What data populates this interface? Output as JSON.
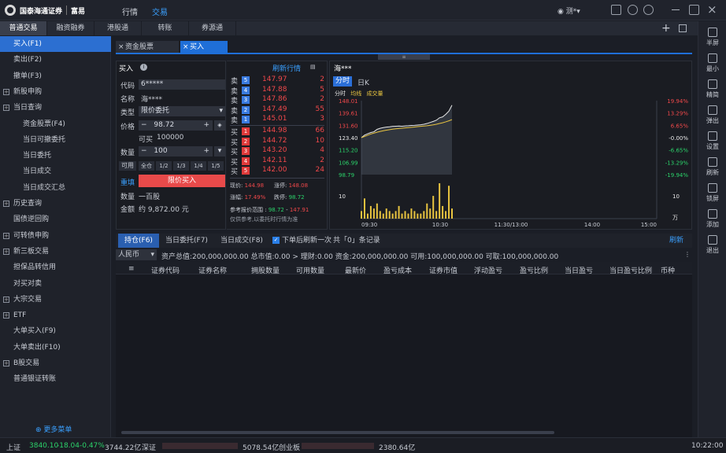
{
  "app": {
    "logo_text": "国泰海通证券",
    "logo_sub": "GUOTAI HAITONG SECURITIES",
    "logo_brand": "富易",
    "logo_brand_sub": "RICH EASY",
    "nav": [
      "行情",
      "交易"
    ],
    "active_nav": 1,
    "user": "测*"
  },
  "subtabs": [
    "普通交易",
    "融资融券",
    "港股通",
    "转账",
    "券源通"
  ],
  "sidebar": {
    "items": [
      {
        "label": "买入(F1)",
        "level": 1,
        "active": true,
        "plus": false
      },
      {
        "label": "卖出(F2)",
        "level": 1,
        "plus": false
      },
      {
        "label": "撤单(F3)",
        "level": 1,
        "plus": false
      },
      {
        "label": "新股申购",
        "level": 1,
        "plus": true
      },
      {
        "label": "当日查询",
        "level": 1,
        "plus": true
      },
      {
        "label": "资金股票(F4)",
        "level": 2
      },
      {
        "label": "当日可撤委托",
        "level": 2
      },
      {
        "label": "当日委托",
        "level": 2
      },
      {
        "label": "当日成交",
        "level": 2
      },
      {
        "label": "当日成交汇总",
        "level": 2
      },
      {
        "label": "历史查询",
        "level": 1,
        "plus": true
      },
      {
        "label": "国债逆回购",
        "level": 1,
        "plus": false
      },
      {
        "label": "可转债申购",
        "level": 1,
        "plus": true
      },
      {
        "label": "新三板交易",
        "level": 1,
        "plus": true
      },
      {
        "label": "担保品转信用",
        "level": 1,
        "plus": false
      },
      {
        "label": "对买对卖",
        "level": 1,
        "plus": false
      },
      {
        "label": "大宗交易",
        "level": 1,
        "plus": true
      },
      {
        "label": "ETF",
        "level": 1,
        "plus": true
      },
      {
        "label": "大单买入(F9)",
        "level": 1,
        "plus": false
      },
      {
        "label": "大单卖出(F10)",
        "level": 1,
        "plus": false
      },
      {
        "label": "B股交易",
        "level": 1,
        "plus": true
      },
      {
        "label": "普通银证转账",
        "level": 1,
        "plus": false
      }
    ],
    "more": "更多菜单"
  },
  "right_toolbar": [
    "半屏",
    "最小",
    "精简",
    "弹出",
    "设置",
    "刷新",
    "锁屏",
    "添加",
    "退出"
  ],
  "doc_tabs": [
    "资金股票",
    "买入"
  ],
  "order": {
    "title": "买入",
    "refresh_quote": "刷新行情",
    "code_label": "代码",
    "code": "6*****",
    "name_label": "名称",
    "name": "海****",
    "type_label": "类型",
    "type": "限价委托",
    "price_label": "价格",
    "price": "98.72",
    "buyable_label": "可买",
    "buyable": "100000",
    "qty_label": "数量",
    "qty": "100",
    "avail_label": "可用",
    "portions": [
      "全仓",
      "1/2",
      "1/3",
      "1/4",
      "1/5"
    ],
    "reset": "重填",
    "submit": "限价买入",
    "qty_text_label": "数量",
    "qty_text": "一百股",
    "amount_label": "金额",
    "amount_text": "约 9,872.00 元"
  },
  "orderbook": {
    "sells": [
      {
        "side": "卖",
        "n": "5",
        "price": "147.97",
        "vol": "2"
      },
      {
        "side": "卖",
        "n": "4",
        "price": "147.88",
        "vol": "5"
      },
      {
        "side": "卖",
        "n": "3",
        "price": "147.86",
        "vol": "2"
      },
      {
        "side": "卖",
        "n": "2",
        "price": "147.49",
        "vol": "55"
      },
      {
        "side": "卖",
        "n": "1",
        "price": "145.01",
        "vol": "3"
      }
    ],
    "buys": [
      {
        "side": "买",
        "n": "1",
        "price": "144.98",
        "vol": "66"
      },
      {
        "side": "买",
        "n": "2",
        "price": "144.72",
        "vol": "10"
      },
      {
        "side": "买",
        "n": "3",
        "price": "143.20",
        "vol": "4"
      },
      {
        "side": "买",
        "n": "4",
        "price": "142.11",
        "vol": "2"
      },
      {
        "side": "买",
        "n": "5",
        "price": "142.00",
        "vol": "24"
      }
    ],
    "now_label": "现价:",
    "now": "144.98",
    "limit_up_label": "涨停:",
    "limit_up": "148.08",
    "change_label": "涨幅:",
    "change": "17.49%",
    "limit_down_label": "跌停:",
    "limit_down": "98.72",
    "ref_label": "参考报价范围",
    "ref_low": "98.72",
    "ref_high": "147.91",
    "note": "仅供参考,以委托时行情为准"
  },
  "chart_panel": {
    "title": "海***",
    "tab_active": "分时",
    "tab_other": "日K",
    "legend": [
      "分时",
      "均线",
      "成交量"
    ],
    "colors": {
      "price": "#e8e8e8",
      "avg": "#e8c440",
      "volume": "#e8c440",
      "up": "#f0484a",
      "down": "#2bd26a"
    }
  },
  "chart_data": {
    "type": "line",
    "y_left_ticks": [
      "148.01",
      "139.61",
      "131.60",
      "123.40",
      "115.20",
      "106.99",
      "98.79"
    ],
    "y_right_ticks": [
      "19.94%",
      "13.29%",
      "6.65%",
      "-0.00%",
      "-6.65%",
      "-13.29%",
      "-19.94%"
    ],
    "ylim": [
      98.79,
      148.01
    ],
    "x_ticks": [
      "09:30",
      "10:30",
      "11:30/13:00",
      "14:00",
      "15:00"
    ],
    "price_series": {
      "name": "分时",
      "values": [
        123.4,
        125.1,
        126.0,
        126.8,
        127.3,
        128.9,
        129.6,
        130.1,
        130.4,
        130.6,
        130.9,
        131.0,
        131.1,
        131.0,
        131.2,
        131.3,
        131.5,
        131.6,
        131.8,
        132.0,
        132.3,
        132.8,
        133.5,
        134.2,
        135.0,
        136.6,
        137.2,
        138.9,
        141.0,
        144.98
      ]
    },
    "avg_series": {
      "name": "均线",
      "values": [
        123.4,
        124.2,
        125.0,
        125.8,
        126.4,
        127.0,
        127.5,
        128.0,
        128.4,
        128.7,
        129.0,
        129.3,
        129.5,
        129.7,
        129.9,
        130.1,
        130.3,
        130.5,
        130.7,
        130.9,
        131.1,
        131.3,
        131.6,
        131.9,
        132.3,
        132.8,
        133.3,
        133.9,
        134.6,
        135.4
      ]
    },
    "volume_ticks": [
      "10",
      "10",
      "万"
    ],
    "volume_values": [
      3,
      8,
      2,
      5,
      4,
      6,
      3,
      2,
      4,
      3,
      2,
      3,
      5,
      2,
      3,
      2,
      4,
      3,
      2,
      2,
      3,
      6,
      4,
      9,
      3,
      14,
      5,
      3,
      13,
      4
    ]
  },
  "bottom": {
    "tabs": [
      "持仓(F6)",
      "当日委托(F7)",
      "当日成交(F8)"
    ],
    "refresh_check": "下单后刷新一次",
    "count_text": "共「0」条记录",
    "refresh": "刷新",
    "currency": "人民币",
    "summary": "资产总值:200,000,000.00  总市值:0.00  >  理财:0.00  资金:200,000,000.00  可用:100,000,000.00  可取:100,000,000.00",
    "columns": [
      "证券代码",
      "证券名称",
      "拥股数量",
      "可用数量",
      "最新价",
      "盈亏成本",
      "证券市值",
      "浮动盈亏",
      "盈亏比例",
      "当日盈亏",
      "当日盈亏比例",
      "币种"
    ]
  },
  "statusbar": {
    "sh_label": "上证",
    "sh_val": "3840.10",
    "sh_chg": "-18.04",
    "sh_pct": "-0.47%",
    "sh_amt": "3744.22亿",
    "sz_label": "深证",
    "sz_amt": "5078.54亿",
    "cy_label": "创业板",
    "cy_amt": "2380.64亿",
    "time": "10:22:00"
  }
}
